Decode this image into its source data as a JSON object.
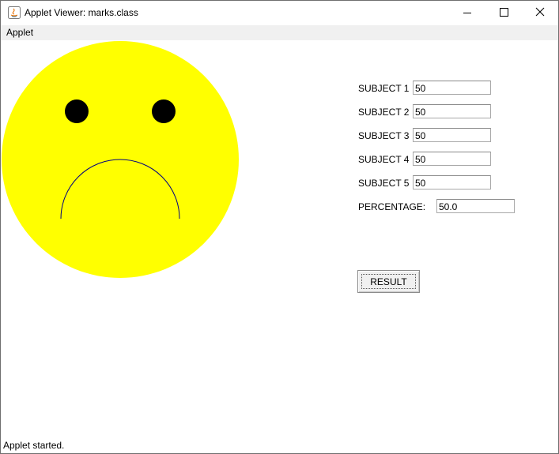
{
  "window": {
    "title": "Applet Viewer: marks.class",
    "icon": "java-icon"
  },
  "menu": {
    "items": [
      "Applet"
    ]
  },
  "form": {
    "subjects": [
      {
        "label": "SUBJECT 1",
        "value": "50"
      },
      {
        "label": "SUBJECT 2",
        "value": "50"
      },
      {
        "label": "SUBJECT 3",
        "value": "50"
      },
      {
        "label": "SUBJECT 4",
        "value": "50"
      },
      {
        "label": "SUBJECT 5",
        "value": "50"
      }
    ],
    "percentage_label": "PERCENTAGE:",
    "percentage_value": "50.0",
    "result_label": "RESULT"
  },
  "face": {
    "expression": "sad",
    "face_color": "#ffff00",
    "eye_color": "#000000",
    "mouth_color": "#000080"
  },
  "status": {
    "text": "Applet started."
  }
}
